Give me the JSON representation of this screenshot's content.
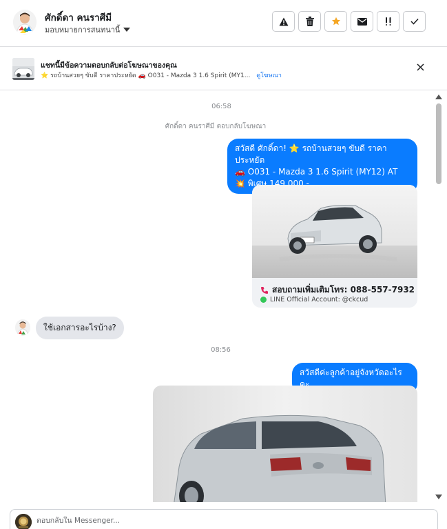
{
  "header": {
    "contact_name": "ศักดิ์ดา คนราศีมี",
    "assign_label": "มอบหมายการสนทนานี้",
    "actions": {
      "spam": "warning-icon",
      "delete": "trash-icon",
      "star": "star-icon",
      "mark_unread": "envelope-icon",
      "follow_up": "exclamation-icon",
      "done": "checkmark-icon"
    }
  },
  "ad_banner": {
    "title": "แชทนี้มีข้อความตอบกลับต่อโฆษณาของคุณ",
    "subtitle": "⭐ รถบ้านสวยๆ ขับดี ราคาประหยัด 🚗 O031 - Mazda 3 1.6 Spirit (MY1...",
    "link": "ดูโฆษณา"
  },
  "conversation": {
    "timestamps": [
      "06:58",
      "08:56"
    ],
    "system_note": "ศักดิ์ดา คนราศีมี ตอบกลับโฆษณา",
    "messages": [
      {
        "direction": "outgoing",
        "lines": [
          "สวัสดี ศักดิ์ดา! ⭐ รถบ้านสวยๆ ขับดี ราคาประหยัด",
          "🚗 O031 - Mazda 3 1.6 Spirit (MY12) AT",
          "💥 พิเศษ 149,000.-"
        ]
      },
      {
        "direction": "outgoing",
        "type": "card",
        "phone_text": "สอบถามเพิ่มเติมโทร: 088-557-7932",
        "line_text": "LINE Official Account: @ckcud"
      },
      {
        "direction": "incoming",
        "text": "ใช้เอกสารอะไรบ้าง?"
      },
      {
        "direction": "outgoing",
        "text": "สวัสดีค่ะลูกค้าอยู่จังหวัดอะไรคะ"
      }
    ]
  },
  "composer": {
    "placeholder": "ตอบกลับใน Messenger..."
  },
  "colors": {
    "accent": "#0a7cff",
    "star": "#f5a623",
    "incoming_bubble": "#e4e6eb"
  }
}
